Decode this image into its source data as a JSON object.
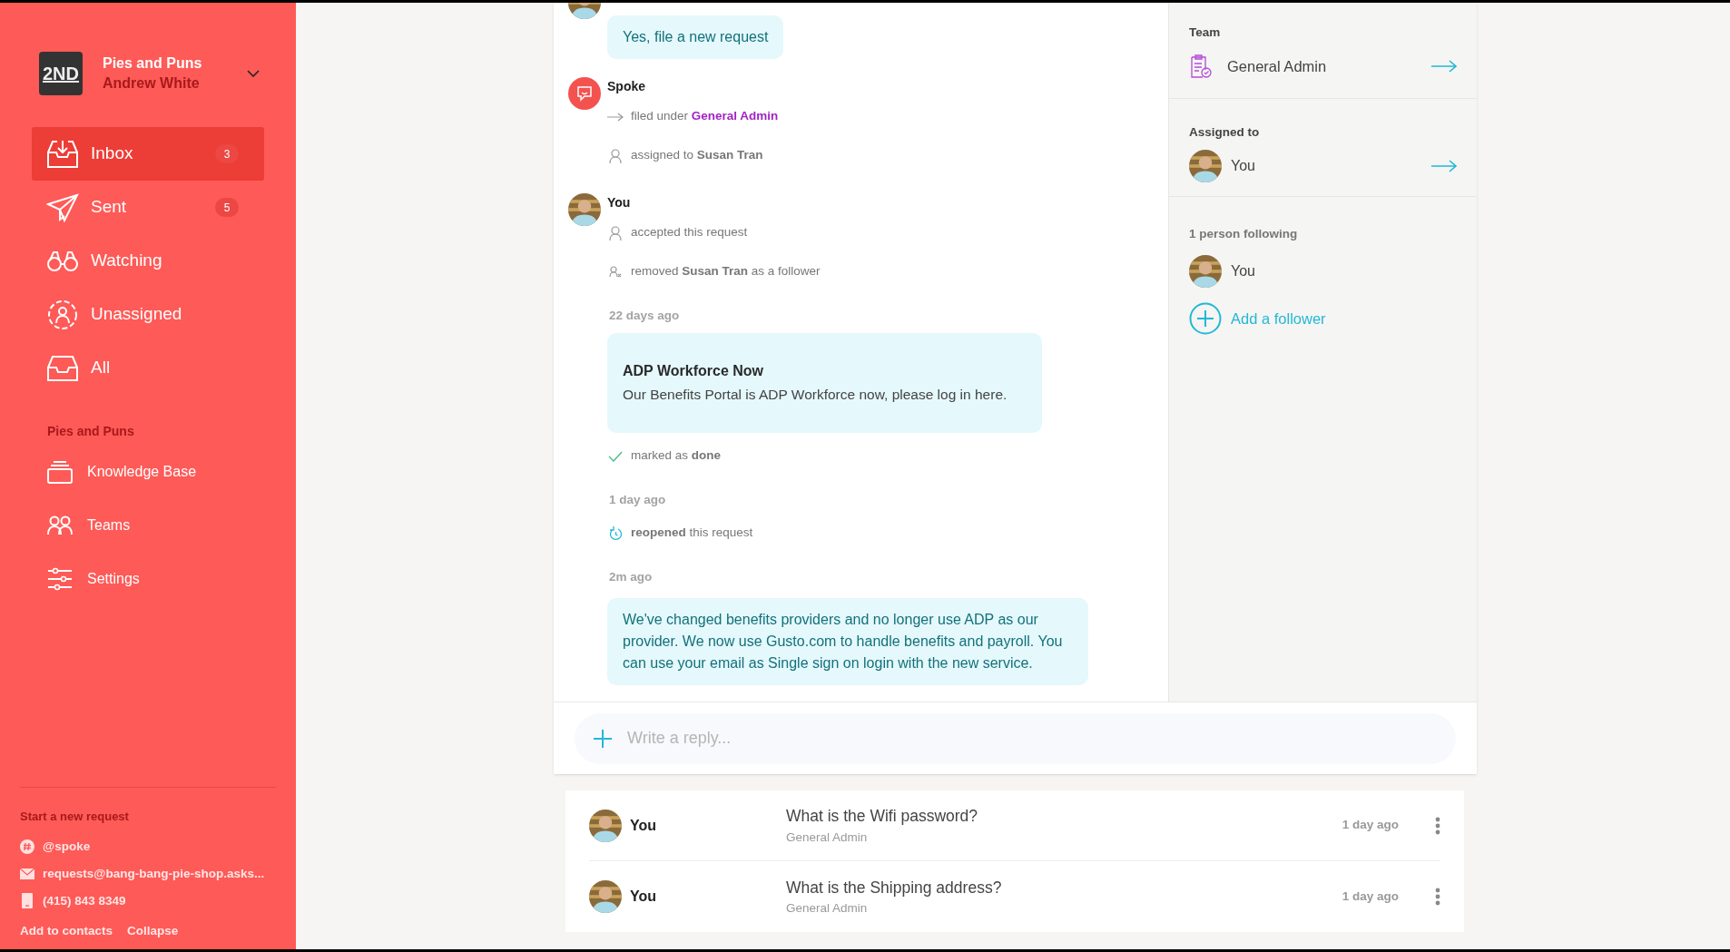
{
  "sidebar": {
    "org": {
      "logo": "2ND",
      "name": "Pies and Puns",
      "user": "Andrew White"
    },
    "nav": [
      {
        "kind": "inbox",
        "label": "Inbox",
        "count": "3",
        "selected": true
      },
      {
        "kind": "sent",
        "label": "Sent",
        "count": "5",
        "selected": false
      },
      {
        "kind": "watching",
        "label": "Watching",
        "selected": false
      },
      {
        "kind": "unassigned",
        "label": "Unassigned",
        "selected": false
      },
      {
        "kind": "all",
        "label": "All",
        "selected": false
      }
    ],
    "section_title": "Pies and Puns",
    "links": [
      {
        "kind": "knowledge",
        "label": "Knowledge Base"
      },
      {
        "kind": "teams",
        "label": "Teams"
      },
      {
        "kind": "settings",
        "label": "Settings"
      }
    ],
    "footer": {
      "title": "Start a new request",
      "contacts": [
        {
          "kind": "slack",
          "text": "@spoke"
        },
        {
          "kind": "email",
          "text": "requests@bang-bang-pie-shop.asks..."
        },
        {
          "kind": "phone",
          "text": "(415) 843 8349"
        }
      ],
      "actions": [
        "Add to contacts",
        "Collapse"
      ]
    }
  },
  "timeline": [
    {
      "kind": "message",
      "text": "Yes, file a new request"
    },
    {
      "kind": "bot_author",
      "name": "Spoke"
    },
    {
      "kind": "filed",
      "text": "filed under",
      "link": "General Admin"
    },
    {
      "kind": "assigned",
      "text": "assigned to **Susan Tran**"
    },
    {
      "kind": "person_author",
      "name": "You"
    },
    {
      "kind": "accepted",
      "text": "accepted this request"
    },
    {
      "kind": "removed",
      "text": "removed **Susan Tran** as a follower"
    },
    {
      "kind": "time",
      "text": "22 days ago"
    },
    {
      "kind": "card",
      "title": "ADP Workforce Now",
      "text": "Our Benefits Portal is ADP Workforce now, please log in here."
    },
    {
      "kind": "done",
      "text": "marked as **done**"
    },
    {
      "kind": "time",
      "text": "1 day ago"
    },
    {
      "kind": "reopened",
      "text": "**reopened** this request"
    },
    {
      "kind": "time",
      "text": "2m ago"
    },
    {
      "kind": "message",
      "text": "We've changed benefits providers and no longer use ADP as our provider. We now use Gusto.com to handle benefits and payroll. You can use your email as Single sign on login with the new service."
    }
  ],
  "reply": {
    "placeholder": "Write a reply..."
  },
  "details": {
    "team": {
      "label": "Team",
      "value": "General Admin"
    },
    "assigned": {
      "label": "Assigned to",
      "value": "You"
    },
    "following": {
      "label": "1 person following",
      "people": [
        "You"
      ],
      "add": "Add a follower"
    }
  },
  "requests": [
    {
      "author": "You",
      "title": "What is the Wifi password?",
      "team": "General Admin",
      "time": "1 day ago"
    },
    {
      "author": "You",
      "title": "What is the Shipping address?",
      "team": "General Admin",
      "time": "1 day ago"
    }
  ]
}
